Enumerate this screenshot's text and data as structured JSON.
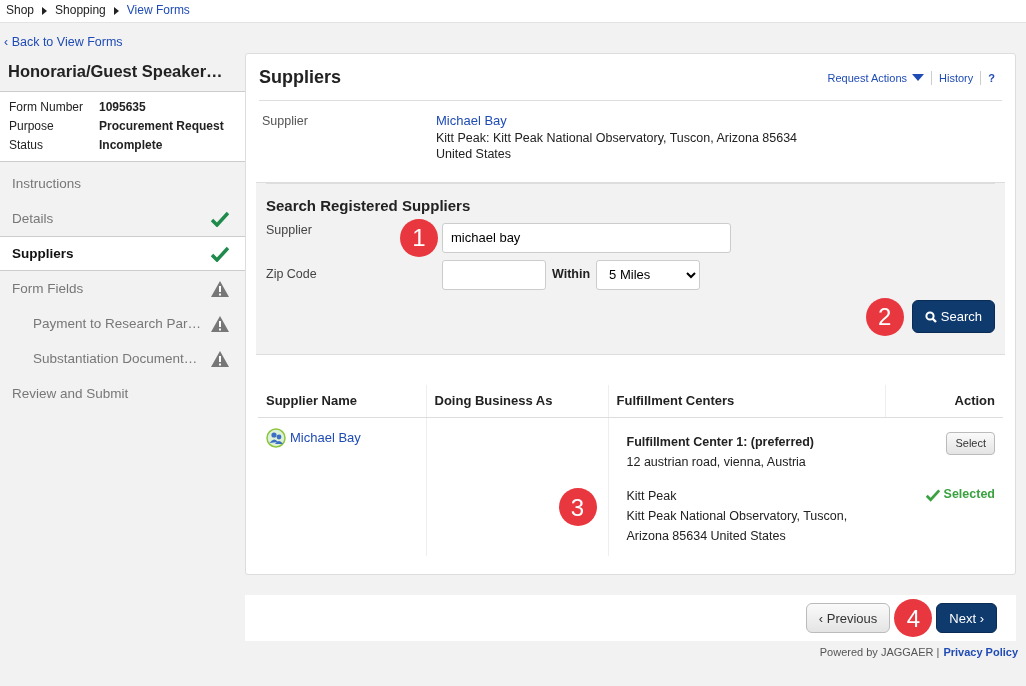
{
  "breadcrumb": [
    {
      "label": "Shop",
      "link": false
    },
    {
      "label": "Shopping",
      "link": false
    },
    {
      "label": "View Forms",
      "link": true
    }
  ],
  "back_link": "‹ Back to View Forms",
  "form": {
    "title": "Honoraria/Guest Speaker…",
    "fields": [
      {
        "label": "Form Number",
        "value": "1095635"
      },
      {
        "label": "Purpose",
        "value": "Procurement Request"
      },
      {
        "label": "Status",
        "value": "Incomplete"
      }
    ]
  },
  "sidebar": {
    "items": [
      {
        "label": "Instructions",
        "selected": false
      },
      {
        "label": "Details",
        "selected": false,
        "kind": "complete"
      },
      {
        "label": "Suppliers",
        "selected": true,
        "kind": "complete"
      },
      {
        "label": "Form Fields",
        "selected": false,
        "kind": "warning",
        "children": [
          {
            "label": "Payment to Research Par…",
            "selected": false,
            "kind": "warning"
          },
          {
            "label": "Substantiation Document…",
            "selected": false,
            "kind": "warning"
          }
        ]
      },
      {
        "label": "Review and Submit",
        "selected": false
      }
    ]
  },
  "panel": {
    "title": "Suppliers",
    "actions": [
      {
        "label": "Request Actions",
        "kind": "dropdown"
      },
      {
        "label": "History",
        "kind": "link"
      },
      {
        "label": "?",
        "kind": "help"
      }
    ],
    "supplier": {
      "label": "Supplier",
      "name": "Michael Bay",
      "address": "Kitt Peak: Kitt Peak National Observatory, Tuscon, Arizona 85634",
      "country": "United States"
    },
    "search": {
      "title": "Search Registered Suppliers",
      "supplier_label": "Supplier",
      "supplier_value": "michael bay",
      "supplier_callout": "1",
      "zip_label": "Zip Code",
      "within_label": "Within",
      "within_value": "5 Miles",
      "button": "Search",
      "button_callout": "2"
    },
    "table": {
      "columns": [
        "Supplier Name",
        "Doing Business As",
        "Fulfillment Centers",
        "Action"
      ],
      "rows": [
        {
          "name": "Michael Bay",
          "centers": [
            {
              "title": "Fulfillment Center 1: (preferred)",
              "title_bold": true,
              "lines": [
                "12 austrian road, vienna, Austria"
              ],
              "selected": false,
              "action": "Select"
            },
            {
              "title": "Kitt Peak",
              "title_bold": false,
              "lines": [
                "Kitt Peak National Observatory, Tuscon,",
                "Arizona 85634 United States"
              ],
              "selected": true,
              "action": "Selected",
              "callout": "3"
            }
          ]
        }
      ]
    }
  },
  "nav": {
    "previous": "‹ Previous",
    "next": "Next ›",
    "next_callout": "4"
  },
  "footer": {
    "text": "Powered by JAGGAER |",
    "link": "Privacy Policy"
  }
}
